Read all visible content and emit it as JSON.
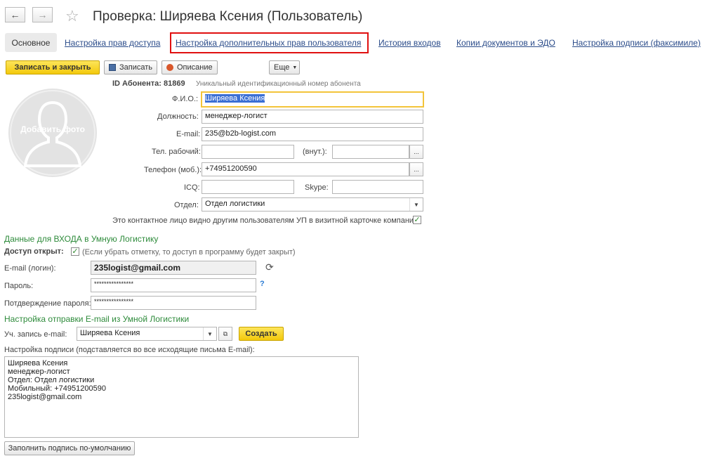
{
  "header": {
    "title": "Проверка: Ширяева Ксения (Пользователь)",
    "back_icon": "←",
    "forward_icon": "→",
    "star_icon": "☆"
  },
  "tabs": [
    "Основное",
    "Настройка прав доступа",
    "Настройка дополнительных прав пользователя",
    "История входов",
    "Копии документов и ЭДО",
    "Настройка подписи (факсимиле)"
  ],
  "toolbar": {
    "save_close": "Записать и закрыть",
    "save": "Записать",
    "description": "Описание",
    "more": "Еще"
  },
  "subscriber": {
    "id_label": "ID Абонента: 81869",
    "id_hint": "Уникальный идентификационный номер абонента"
  },
  "photo": {
    "label": "Добавить фото"
  },
  "form": {
    "fio_label": "Ф.И.О.:",
    "fio_value": "Ширяева Ксения",
    "position_label": "Должность:",
    "position_value": "менеджер-логист",
    "email_label": "E-mail:",
    "email_value": "235@b2b-logist.com",
    "work_phone_label": "Тел. рабочий:",
    "work_phone_value": "",
    "ext_label": "(внут.):",
    "ext_value": "",
    "mobile_label": "Телефон (моб.):",
    "mobile_value": "+74951200590",
    "icq_label": "ICQ:",
    "icq_value": "",
    "skype_label": "Skype:",
    "skype_value": "",
    "dept_label": "Отдел:",
    "dept_value": "Отдел логистики",
    "visible_label": "Это контактное лицо видно другим пользователям УП в визитной карточке компании:"
  },
  "login": {
    "section_title": "Данные для ВХОДА в Умную Логистику",
    "access_label": "Доступ открыт:",
    "access_hint": "(Если убрать отметку, то доступ в программу будет закрыт)",
    "email_label": "E-mail (логин):",
    "email_value": "235logist@gmail.com",
    "password_label": "Пароль:",
    "password_value": "****************",
    "help": "?",
    "confirm_label": "Потдверждение пароля:",
    "confirm_value": "****************"
  },
  "mail": {
    "section_title": "Настройка отправки E-mail из Умной Логистики",
    "account_label": "Уч. запись e-mail:",
    "account_value": "Ширяева Ксения",
    "create_label": "Создать",
    "signature_label": "Настройка подписи (подставляется во все исходящие письма E-mail):",
    "signature_lines": [
      "Ширяева Ксения",
      "менеджер-логист",
      "Отдел: Отдел логистики",
      "Мобильный: +74951200590",
      "235logist@gmail.com"
    ],
    "fill_default_label": "Заполнить подпись по-умолчанию"
  },
  "colors": {
    "accent_yellow": "#f3c90c",
    "highlight_red": "#e01010",
    "section_green": "#2e8b3b",
    "link_blue": "#2b4c8a"
  }
}
